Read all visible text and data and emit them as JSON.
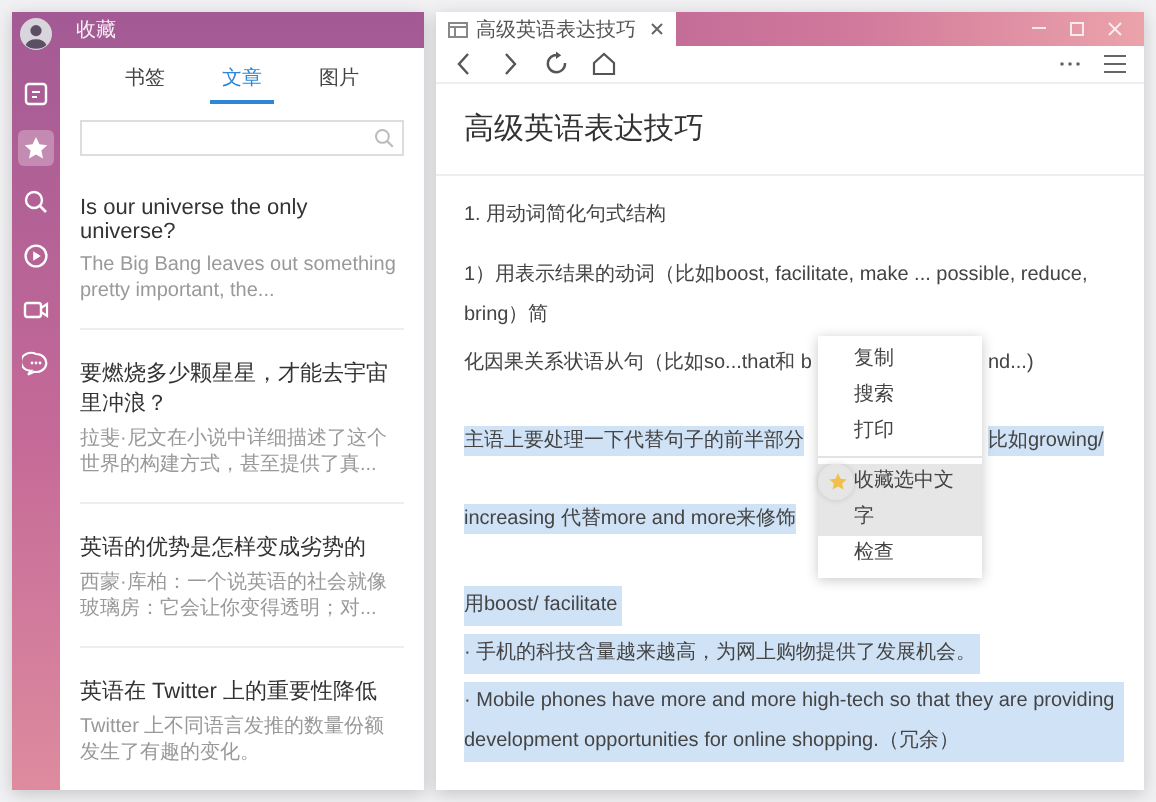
{
  "favorites_window": {
    "title": "收藏",
    "sidebar": [
      {
        "kind": "reader",
        "selected": false
      },
      {
        "kind": "favorites",
        "selected": true
      },
      {
        "kind": "search",
        "selected": false
      },
      {
        "kind": "media",
        "selected": false
      },
      {
        "kind": "video",
        "selected": false
      },
      {
        "kind": "chat",
        "selected": false
      }
    ],
    "tabs": [
      {
        "label": "书签",
        "selected": false
      },
      {
        "label": "文章",
        "selected": true
      },
      {
        "label": "图片",
        "selected": false
      }
    ],
    "articles": [
      {
        "title": "Is our universe the only universe?",
        "snippet": "The Big Bang leaves out something pretty important, the..."
      },
      {
        "title": "要燃烧多少颗星星，才能去宇宙里冲浪？",
        "snippet": "拉斐·尼文在小说中详细描述了这个世界的构建方式，甚至提供了真..."
      },
      {
        "title": "英语的优势是怎样变成劣势的",
        "snippet": "西蒙·库柏：一个说英语的社会就像玻璃房：它会让你变得透明；对..."
      },
      {
        "title": "英语在 Twitter 上的重要性降低",
        "snippet": "Twitter 上不同语言发推的数量份额发生了有趣的变化。"
      }
    ]
  },
  "browser": {
    "tabs": [
      {
        "label": "高级英语表达技巧",
        "selected": true
      }
    ],
    "article": {
      "title": "高级英语表达技巧",
      "section": "1. 用动词简化句式结构",
      "intro": "1）用表示结果的动词（比如boost, facilitate, make ... possible, reduce, bring）简",
      "covered_lines": [
        {
          "left": "化因果关系状语从句（比如so...that和 b",
          "right": "nd...)",
          "highlighted": false
        },
        {
          "left": "主语上要处理一下代替句子的前半部分",
          "right": "比如growing/",
          "highlighted": true
        },
        {
          "left": "increasing  代替more and more来修饰",
          "highlighted": true
        }
      ],
      "paragraphs": [
        {
          "text": "用boost/ facilitate",
          "highlighted": true
        },
        {
          "text": "· 手机的科技含量越来越高，为网上购物提供了发展机会。",
          "highlighted": true
        },
        {
          "text": "· Mobile phones have more and more high-tech so that  they are providing development opportunities for online shopping.（冗余）",
          "highlighted": true
        }
      ]
    },
    "context_menu": [
      {
        "kind": "action",
        "label": "复制",
        "selected": false,
        "has_icon": false
      },
      {
        "kind": "action",
        "label": "搜索",
        "selected": false,
        "has_icon": false
      },
      {
        "kind": "action",
        "label": "打印",
        "selected": false,
        "has_icon": false
      },
      {
        "kind": "separator"
      },
      {
        "kind": "action",
        "label": "收藏选中文字",
        "selected": true,
        "has_icon": true
      },
      {
        "kind": "action",
        "label": "检查",
        "selected": false,
        "has_icon": false
      }
    ]
  }
}
